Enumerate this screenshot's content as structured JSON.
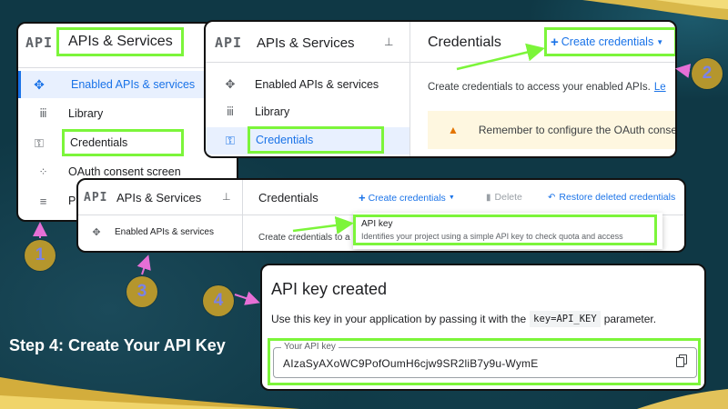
{
  "card1": {
    "logo": "API",
    "title": "APIs & Services",
    "nav": [
      {
        "label": "Enabled APIs & services",
        "icon": "enabled-apis-icon"
      },
      {
        "label": "Library",
        "icon": "library-icon"
      },
      {
        "label": "Credentials",
        "icon": "key-icon"
      },
      {
        "label": "OAuth consent screen",
        "icon": "oauth-icon"
      },
      {
        "label": "P",
        "icon": "settings-list-icon"
      }
    ]
  },
  "card2": {
    "logo": "API",
    "title": "APIs & Services",
    "nav": [
      {
        "label": "Enabled APIs & services",
        "icon": "enabled-apis-icon"
      },
      {
        "label": "Library",
        "icon": "library-icon"
      },
      {
        "label": "Credentials",
        "icon": "key-icon"
      }
    ],
    "page_title": "Credentials",
    "create_button": "Create credentials",
    "description": "Create credentials to access your enabled APIs.",
    "learn_link": "Le",
    "warning": "Remember to configure the OAuth conse"
  },
  "card3": {
    "logo": "API",
    "title": "APIs & Services",
    "nav": [
      {
        "label": "Enabled APIs & services",
        "icon": "enabled-apis-icon"
      }
    ],
    "page_title": "Credentials",
    "create_button": "Create credentials",
    "delete_button": "Delete",
    "restore_button": "Restore deleted credentials",
    "description": "Create credentials to a",
    "menu": {
      "item_title": "API key",
      "item_desc": "Identifies your project using a simple API key to check quota and access"
    }
  },
  "card4": {
    "title": "API key created",
    "text_before": "Use this key in your application by passing it with the",
    "code": "key=API_KEY",
    "text_after": "parameter.",
    "field_label": "Your API key",
    "field_value": "AIzaSyAXoWC9PofOumH6cjw9SR2liB7y9u-WymE"
  },
  "badges": [
    "1",
    "2",
    "3",
    "4"
  ],
  "caption": "Step 4: Create Your API Key",
  "colors": {
    "highlight": "#7cf53a",
    "badge_bg": "#b5962d",
    "badge_text": "#7b82e6",
    "arrow": "#e66fd6",
    "google_blue": "#1a73e8"
  }
}
